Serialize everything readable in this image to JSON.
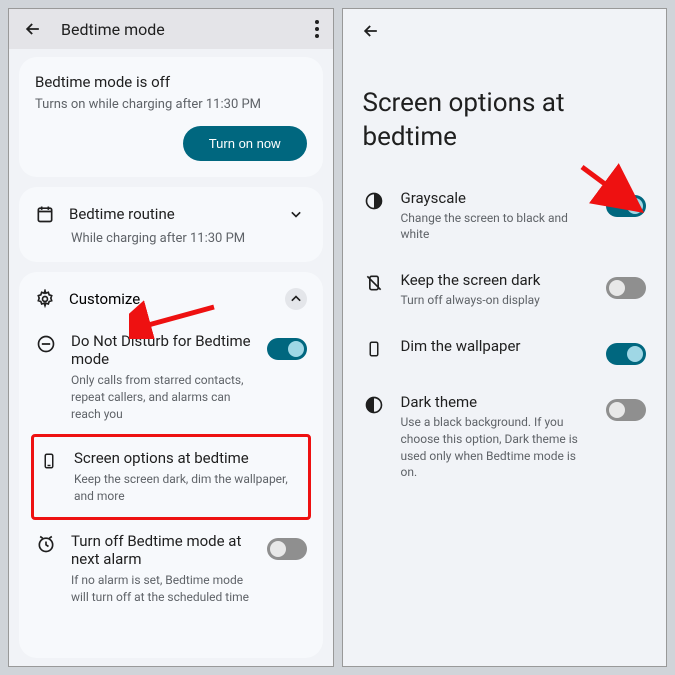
{
  "colors": {
    "accent": "#00677f",
    "highlight": "#e11"
  },
  "left": {
    "title": "Bedtime mode",
    "status": {
      "title": "Bedtime mode is off",
      "subtitle": "Turns on while charging after 11:30 PM",
      "button": "Turn on now"
    },
    "routine": {
      "label": "Bedtime routine",
      "subtitle": "While charging after 11:30 PM"
    },
    "customize": {
      "label": "Customize",
      "items": [
        {
          "icon": "dnd",
          "title": "Do Not Disturb for Bedtime mode",
          "subtitle": "Only calls from starred contacts, repeat callers, and alarms can reach you",
          "toggle": true
        },
        {
          "icon": "screen",
          "title": "Screen options at bedtime",
          "subtitle": "Keep the screen dark, dim the wallpaper, and more",
          "toggle": null,
          "highlight": true
        },
        {
          "icon": "alarm",
          "title": "Turn off Bedtime mode at next alarm",
          "subtitle": "If no alarm is set, Bedtime mode will turn off at the scheduled time",
          "toggle": false
        }
      ]
    }
  },
  "right": {
    "title": "Screen options at bedtime",
    "options": [
      {
        "icon": "grayscale",
        "title": "Grayscale",
        "subtitle": "Change the screen to black and white",
        "toggle": true,
        "arrow": true
      },
      {
        "icon": "nodisplay",
        "title": "Keep the screen dark",
        "subtitle": "Turn off always-on display",
        "toggle": false
      },
      {
        "icon": "dim",
        "title": "Dim the wallpaper",
        "subtitle": "",
        "toggle": true
      },
      {
        "icon": "dark",
        "title": "Dark theme",
        "subtitle": "Use a black background. If you choose this option, Dark theme is used only when Bedtime mode is on.",
        "toggle": false
      }
    ]
  }
}
